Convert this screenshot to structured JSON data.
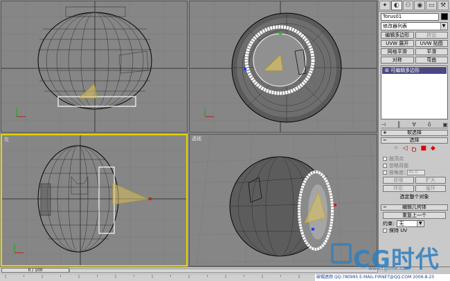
{
  "viewports": {
    "top": {
      "label": ""
    },
    "front": {
      "label": ""
    },
    "left": {
      "label": "左"
    },
    "perspective": {
      "label": "透视"
    }
  },
  "panel": {
    "tabs": [
      "create-icon",
      "modify-icon",
      "hierarchy-icon",
      "motion-icon",
      "display-icon",
      "utilities-icon"
    ],
    "object_name": "Torus01",
    "object_color": "#000000",
    "modifier_list": "修改器列表",
    "buttons": [
      {
        "label": "编辑多边形",
        "enabled": true
      },
      {
        "label": "挤出",
        "enabled": false
      },
      {
        "label": "UVW 展开",
        "enabled": true
      },
      {
        "label": "UVW 贴图",
        "enabled": true
      },
      {
        "label": "网格平滑",
        "enabled": true
      },
      {
        "label": "平滑",
        "enabled": true
      },
      {
        "label": "对称",
        "enabled": true
      },
      {
        "label": "弯曲",
        "enabled": true
      }
    ],
    "stack_item": "可编辑多边形",
    "rollouts": {
      "soft_selection": "软选择",
      "selection": "选择",
      "edit_geometry": "编辑几何体"
    },
    "selection": {
      "by_vertex": "按顶点",
      "ignore_backfacing": "忽略背面",
      "by_angle": "按角度:",
      "angle_value": "45.0",
      "shrink": "收缩",
      "grow": "扩大",
      "ring": "环形",
      "loop": "循环",
      "status": "选定整个对象"
    },
    "edit_geometry": {
      "repeat_last": "重复上一个",
      "constraints_label": "约束:",
      "constraints_value": "无",
      "preserve_uvs": "保持 UV"
    }
  },
  "timeline": {
    "frame": "0 / 100"
  },
  "footer": {
    "text": "破帽遮颜 QQ:780995 E-MAIL:FIRNET@QQ.COM 2006-8-25"
  },
  "brand": {
    "name": "CG时代",
    "url": "www.cgtime.com"
  }
}
